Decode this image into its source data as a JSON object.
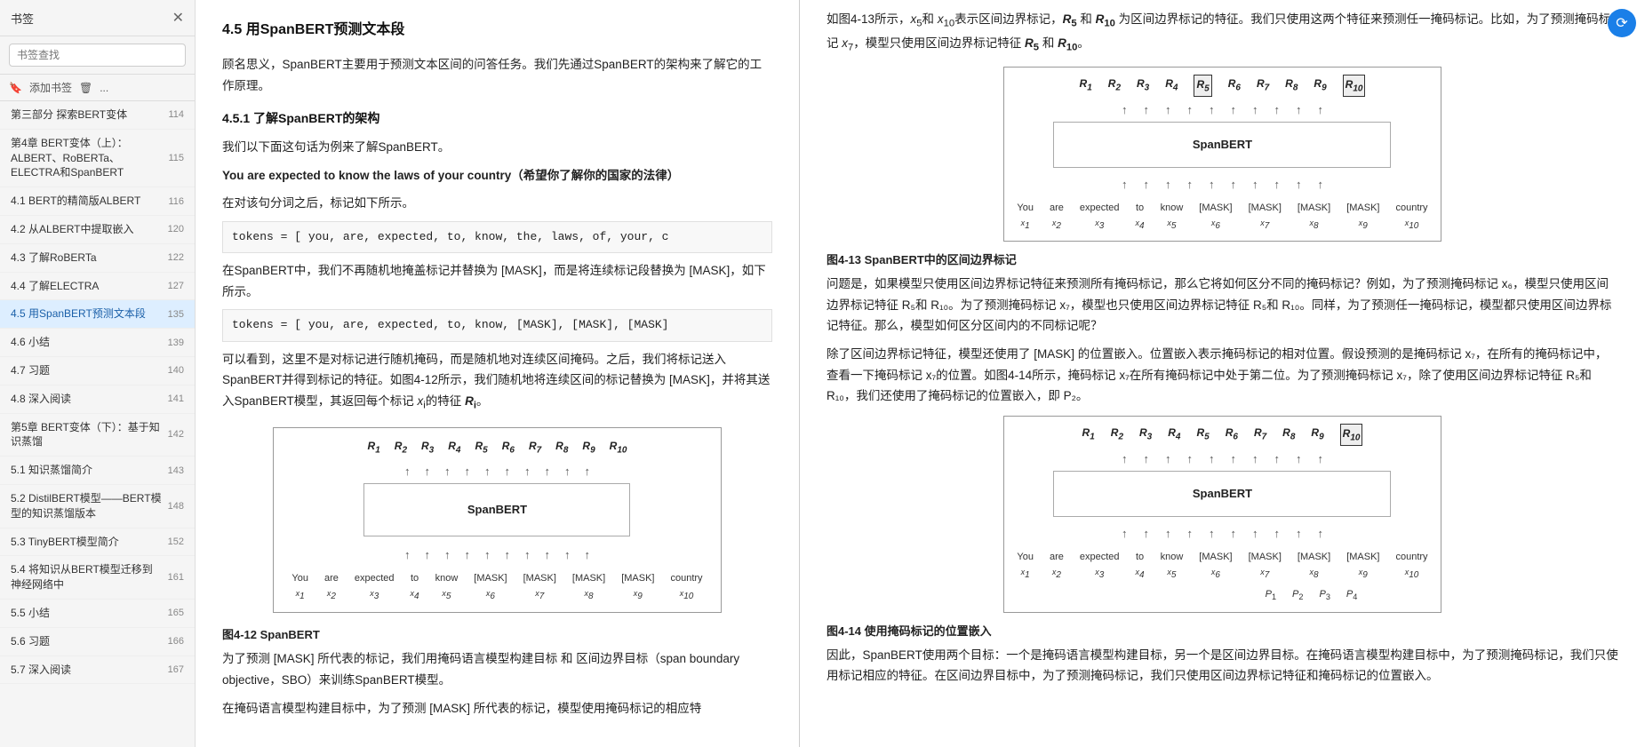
{
  "sidebar": {
    "title": "书签",
    "search_placeholder": "书签查找",
    "add_label": "添加书签",
    "delete_label": "删除",
    "more_label": "...",
    "items": [
      {
        "id": "item1",
        "text": "第三部分 探索BERT变体",
        "page": "114"
      },
      {
        "id": "item2",
        "text": "第4章 BERT变体（上）：ALBERT、RoBERTa、ELECTRA和SpanBERT",
        "page": "115"
      },
      {
        "id": "item3",
        "text": "4.1 BERT的精简版ALBERT",
        "page": "116"
      },
      {
        "id": "item4",
        "text": "4.2 从ALBERT中提取嵌入",
        "page": "120"
      },
      {
        "id": "item5",
        "text": "4.3 了解RoBERTa",
        "page": "122"
      },
      {
        "id": "item6",
        "text": "4.4 了解ELECTRA",
        "page": "127"
      },
      {
        "id": "item7",
        "text": "4.5 用SpanBERT预测文本段",
        "page": "135",
        "active": true
      },
      {
        "id": "item8",
        "text": "4.6 小结",
        "page": "139"
      },
      {
        "id": "item9",
        "text": "4.7 习题",
        "page": "140"
      },
      {
        "id": "item10",
        "text": "4.8 深入阅读",
        "page": "141"
      },
      {
        "id": "item11",
        "text": "第5章 BERT变体（下）：基于知识蒸馏",
        "page": "142"
      },
      {
        "id": "item12",
        "text": "5.1 知识蒸馏简介",
        "page": "143"
      },
      {
        "id": "item13",
        "text": "5.2 DistilBERT模型——BERT模型的知识蒸馏版本",
        "page": "148"
      },
      {
        "id": "item14",
        "text": "5.3 TinyBERT模型简介",
        "page": "152"
      },
      {
        "id": "item15",
        "text": "5.4 将知识从BERT模型迁移到神经网络中",
        "page": "161"
      },
      {
        "id": "item16",
        "text": "5.5 小结",
        "page": "165"
      },
      {
        "id": "item17",
        "text": "5.6 习题",
        "page": "166"
      },
      {
        "id": "item18",
        "text": "5.7 深入阅读",
        "page": "167"
      }
    ]
  },
  "left_panel": {
    "section": "4.5  用SpanBERT预测文本段",
    "intro": "顾名思义，SpanBERT主要用于预测文本区间的问答任务。我们先通过SpanBERT的架构来了解它的工作原理。",
    "subsection": "4.5.1  了解SpanBERT的架构",
    "example_intro": "我们以下面这句话为例来了解SpanBERT。",
    "example_sentence": "You are expected to know the laws of your country（希望你了解你的国家的法律）",
    "after_sentence": "在对该句分词之后，标记如下所示。",
    "tokens1": "tokens = [ you, are, expected, to, know, the, laws, of, your, c",
    "spanbert_intro": "在SpanBERT中，我们不再随机地掩盖标记并替换为 [MASK]，而是将连续标记段替换为 [MASK]，如下所示。",
    "tokens2": "tokens = [ you, are, expected, to, know, [MASK], [MASK], [MASK]",
    "explain": "可以看到，这里不是对标记进行随机掩码，而是随机地对连续区间掩码。之后，我们将标记送入SpanBERT并得到标记的特征。如图4-12所示，我们随机地将连续区间的标记替换为 [MASK]，并将其送入SpanBERT模型，其返回每个标记 xᵢ的特征 Rᵢ。",
    "diagram1": {
      "r_labels": [
        "R₁",
        "R₂",
        "R₃",
        "R₄",
        "R₅",
        "R₆",
        "R₇",
        "R₈",
        "R₉",
        "R₁₀"
      ],
      "model": "SpanBERT",
      "tokens": [
        "You",
        "are",
        "expected",
        "to",
        "know",
        "[MASK]",
        "[MASK]",
        "[MASK]",
        "[MASK]",
        "country"
      ],
      "x_labels": [
        "x₁",
        "x₂",
        "x₃",
        "x₄",
        "x₅",
        "x₆",
        "x₇",
        "x₈",
        "x₉",
        "x₁₀"
      ]
    },
    "fig_caption": "图4-12  SpanBERT",
    "predict_intro": "为了预测 [MASK] 所代表的标记，我们用掩码语言模型构建目标 和 区间边界目标（span boundary objective，SBO）来训练SpanBERT模型。",
    "mlm_intro": "在掩码语言模型构建目标中，为了预测 [MASK] 所代表的标记，模型使用掩码标记的相应特"
  },
  "right_panel": {
    "intro_text": "如图4-13所示，x₅和 x₁₀表示区间边界标记，R₅ 和 R₁₀ 为区间边界标记的特征。我们只使用这两个特征来预测任一掩码标记。比如，为了预测掩码标记 x₇，模型只使用区间边界标记特征 R₅ 和 R₁₀。",
    "diagram2": {
      "r_labels": [
        "R₁",
        "R₂",
        "R₃",
        "R₄",
        "R₅",
        "R₆",
        "R₇",
        "R₈",
        "R₉",
        "R₁₀"
      ],
      "highlight_r5": "R₅",
      "highlight_r10": "R₁₀",
      "model": "SpanBERT",
      "tokens": [
        "You",
        "are",
        "expected",
        "to",
        "know",
        "[MASK]",
        "[MASK]",
        "[MASK]",
        "[MASK]",
        "country"
      ],
      "x_labels": [
        "x₁",
        "x₂",
        "x₃",
        "x₄",
        "x₅",
        "x₆",
        "x₇",
        "x₈",
        "x₉",
        "x₁₀"
      ]
    },
    "fig2_caption": "图4-13  SpanBERT中的区间边界标记",
    "problem_text": "问题是，如果模型只使用区间边界标记特征来预测所有掩码标记，那么它将如何区分不同的掩码标记？例如，为了预测掩码标记 x₆，模型只使用区间边界标记特征 R₅和 R₁₀。为了预测掩码标记 x₇，模型也只使用区间边界标记特征 R₅和 R₁₀。同样，为了预测任一掩码标记，模型都只使用区间边界标记特征。那么，模型如何区分区间内的不同标记呢？",
    "position_text": "除了区间边界标记特征，模型还使用了 [MASK] 的位置嵌入。位置嵌入表示掩码标记的相对位置。假设预测的是掩码标记 x₇，在所有的掩码标记中，查看一下掩码标记 x₇的位置。如图4-14所示，掩码标记 x₇在所有掩码标记中处于第二位。为了预测掩码标记 x₇，除了使用区间边界标记特征 R₅和 R₁₀，我们还使用了掩码标记的位置嵌入，即 P₂。",
    "diagram3": {
      "r_labels": [
        "R₁",
        "R₂",
        "R₃",
        "R₄",
        "R₅",
        "R₆",
        "R₇",
        "R₈",
        "R₉",
        "R₁₀"
      ],
      "model": "SpanBERT",
      "tokens": [
        "You",
        "are",
        "expected",
        "to",
        "know",
        "[MASK]",
        "[MASK]",
        "[MASK]",
        "[MASK]",
        "country"
      ],
      "x_labels": [
        "x₁",
        "x₂",
        "x₃",
        "x₄",
        "x₅",
        "x₆",
        "x₇",
        "x₈",
        "x₉",
        "x₁₀"
      ],
      "p_labels": [
        "P₁",
        "P₂",
        "P₃",
        "P₄"
      ]
    },
    "fig3_caption": "图4-14  使用掩码标记的位置嵌入",
    "conclusion_text": "因此，SpanBERT使用两个目标：一个是掩码语言模型构建目标，另一个是区间边界目标。在掩码语言模型构建目标中，为了预测掩码标记，我们只使用标记相应的特征。在区间边界目标中，为了预测掩码标记，我们只使用区间边界标记特征和掩码标记的位置嵌入。"
  }
}
